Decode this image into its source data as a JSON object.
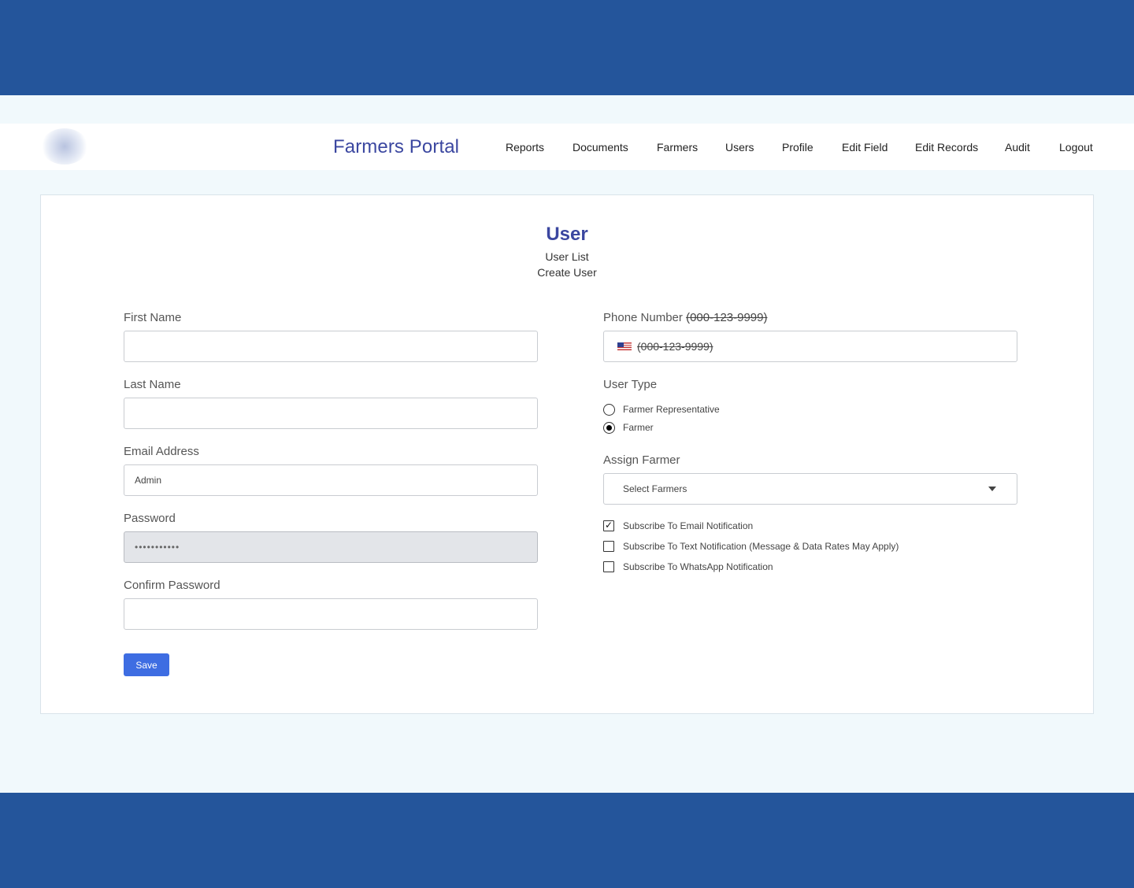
{
  "brand": {
    "title": "Farmers Portal",
    "logo_icon": "seal-logo-icon"
  },
  "nav": [
    "Reports",
    "Documents",
    "Farmers",
    "Users",
    "Profile",
    "Edit Field",
    "Edit Records",
    "Audit",
    "Logout"
  ],
  "page": {
    "title": "User",
    "links": [
      "User List",
      "Create User"
    ]
  },
  "form": {
    "first_name": {
      "label": "First Name",
      "value": ""
    },
    "last_name": {
      "label": "Last Name",
      "value": ""
    },
    "email": {
      "label": "Email Address",
      "value": "Admin"
    },
    "password": {
      "label": "Password",
      "value": "•••••••••••"
    },
    "confirm_password": {
      "label": "Confirm Password",
      "value": ""
    },
    "phone": {
      "label": "Phone Number",
      "format_hint": "(000-123-9999)",
      "value": "(000-123-9999)",
      "flag_icon": "us-flag-icon"
    },
    "user_type": {
      "label": "User Type",
      "options": [
        {
          "label": "Farmer Representative",
          "selected": false
        },
        {
          "label": "Farmer",
          "selected": true
        }
      ]
    },
    "assign_farmer": {
      "label": "Assign Farmer",
      "placeholder": "Select Farmers"
    },
    "subscriptions": [
      {
        "label": "Subscribe To Email Notification",
        "checked": true
      },
      {
        "label": "Subscribe To Text Notification (Message & Data Rates May Apply)",
        "checked": false
      },
      {
        "label": "Subscribe To WhatsApp Notification",
        "checked": false
      }
    ],
    "save_label": "Save"
  },
  "colors": {
    "outer_background": "#24559b",
    "brand": "#3b47a0",
    "primary_button": "#3e6de2",
    "page_background": "#f1f9fc"
  }
}
